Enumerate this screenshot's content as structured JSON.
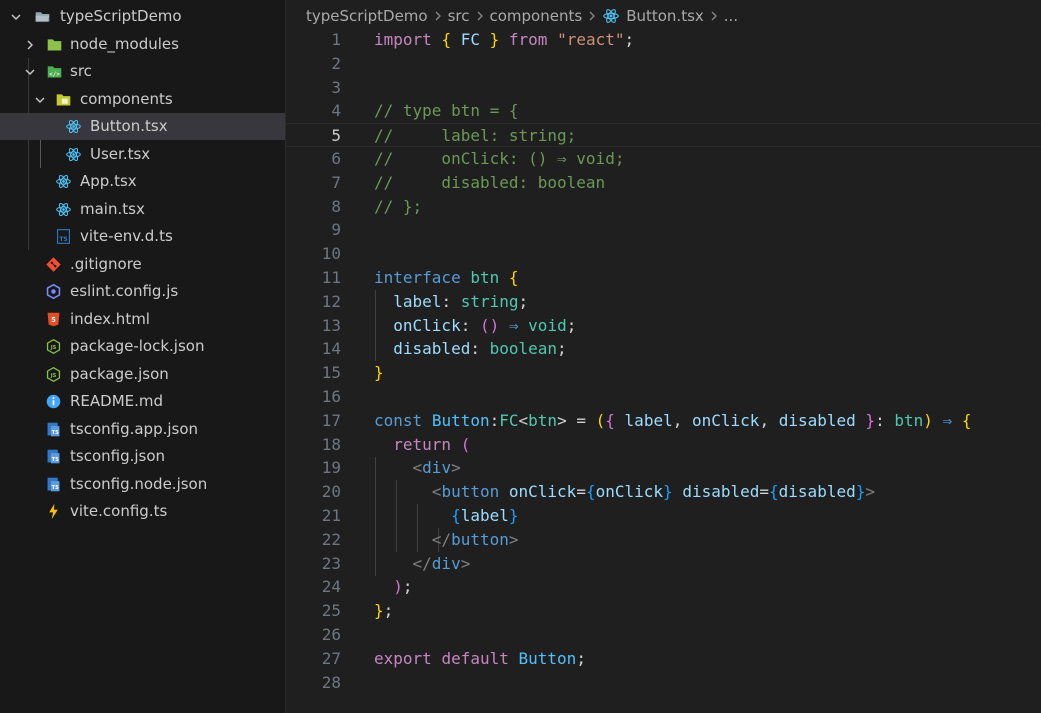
{
  "explorer": {
    "root": "typeScriptDemo",
    "items": [
      {
        "label": "node_modules"
      },
      {
        "label": "src"
      },
      {
        "label": "components"
      },
      {
        "label": "Button.tsx"
      },
      {
        "label": "User.tsx"
      },
      {
        "label": "App.tsx"
      },
      {
        "label": "main.tsx"
      },
      {
        "label": "vite-env.d.ts"
      },
      {
        "label": ".gitignore"
      },
      {
        "label": "eslint.config.js"
      },
      {
        "label": "index.html"
      },
      {
        "label": "package-lock.json"
      },
      {
        "label": "package.json"
      },
      {
        "label": "README.md"
      },
      {
        "label": "tsconfig.app.json"
      },
      {
        "label": "tsconfig.json"
      },
      {
        "label": "tsconfig.node.json"
      },
      {
        "label": "vite.config.ts"
      }
    ]
  },
  "breadcrumb": {
    "project": "typeScriptDemo",
    "folder1": "src",
    "folder2": "components",
    "file": "Button.tsx",
    "more": "..."
  },
  "editor": {
    "line_numbers": [
      "1",
      "2",
      "3",
      "4",
      "5",
      "6",
      "7",
      "8",
      "9",
      "10",
      "11",
      "12",
      "13",
      "14",
      "15",
      "16",
      "17",
      "18",
      "19",
      "20",
      "21",
      "22",
      "23",
      "24",
      "25",
      "26",
      "27",
      "28"
    ],
    "active_line": 5
  },
  "colors": {
    "react": "#4fc3f7",
    "ts": "#3178c6",
    "git": "#f14e32",
    "html": "#e44d26",
    "json": "#8bc34a",
    "eslint": "#7c8cff",
    "info": "#42a5f5",
    "vite": "#ffc107"
  }
}
